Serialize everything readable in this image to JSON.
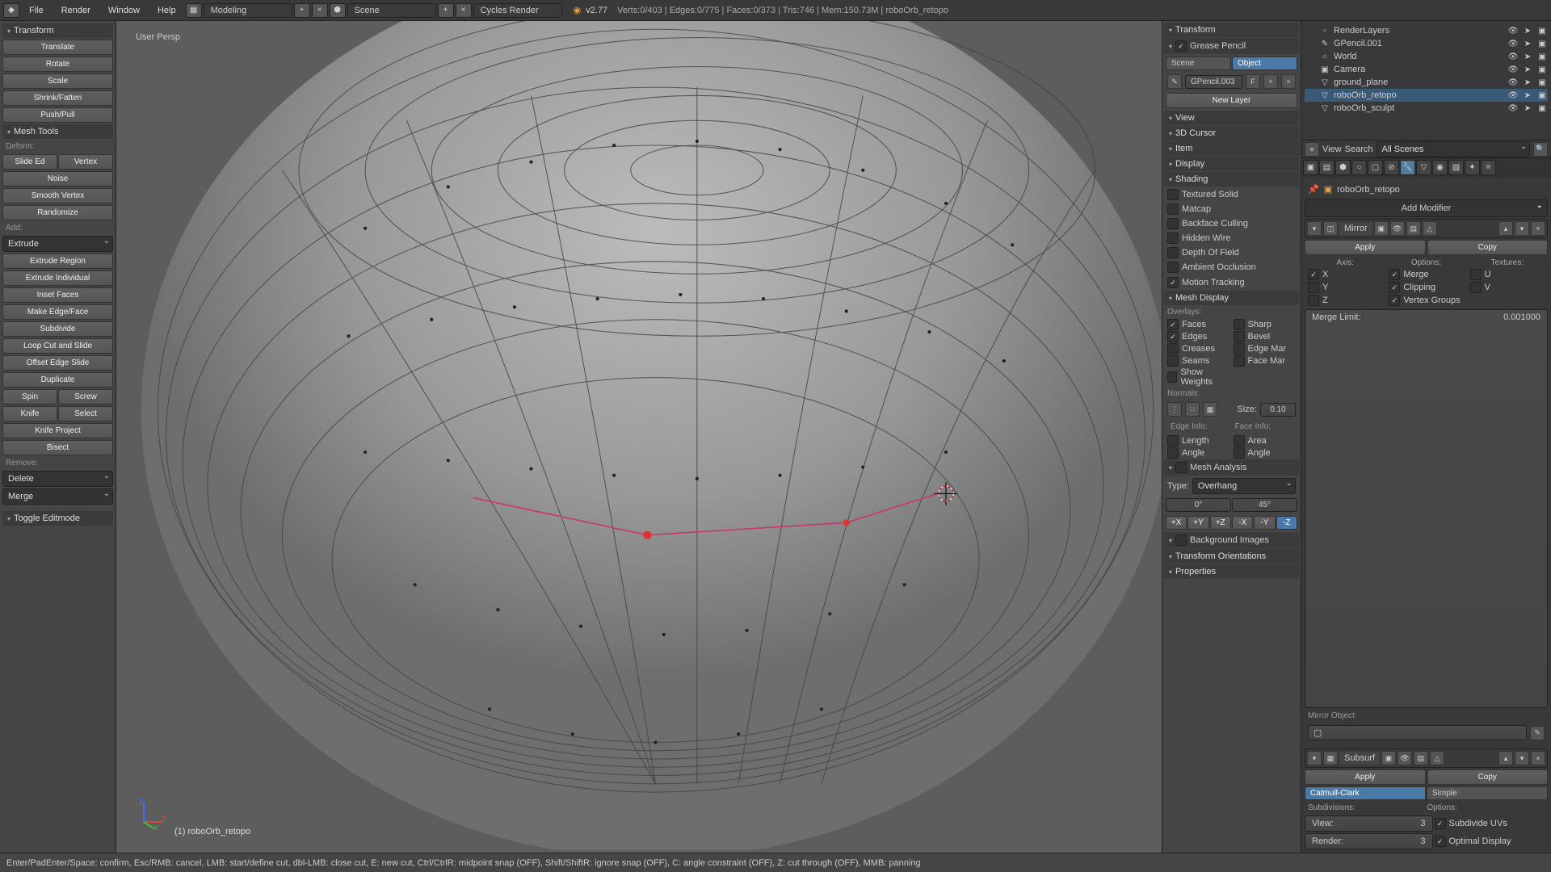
{
  "topbar": {
    "menus": [
      "File",
      "Render",
      "Window",
      "Help"
    ],
    "layout": "Modeling",
    "scene": "Scene",
    "engine": "Cycles Render",
    "version": "v2.77",
    "stats": "Verts:0/403 | Edges:0/775 | Faces:0/373 | Tris:746 | Mem:150.73M | roboOrb_retopo"
  },
  "toolshelf": {
    "transform_head": "Transform",
    "transform": [
      "Translate",
      "Rotate",
      "Scale",
      "Shrink/Fatten",
      "Push/Pull"
    ],
    "mesh_head": "Mesh Tools",
    "deform_label": "Deform:",
    "deform_pair": [
      "Slide Ed",
      "Vertex"
    ],
    "deform": [
      "Noise",
      "Smooth Vertex",
      "Randomize"
    ],
    "add_label": "Add:",
    "extrude": "Extrude",
    "add": [
      "Extrude Region",
      "Extrude Individual",
      "Inset Faces",
      "Make Edge/Face",
      "Subdivide",
      "Loop Cut and Slide",
      "Offset Edge Slide",
      "Duplicate"
    ],
    "spin_pair": [
      "Spin",
      "Screw"
    ],
    "knife_pair": [
      "Knife",
      "Select"
    ],
    "knife": [
      "Knife Project",
      "Bisect"
    ],
    "remove_label": "Remove:",
    "remove": [
      "Delete",
      "Merge"
    ],
    "history_head": "Toggle Editmode"
  },
  "viewport": {
    "persp": "User Persp",
    "object": "(1) roboOrb_retopo"
  },
  "npanel": {
    "sections_collapsed": [
      "Transform"
    ],
    "gp_head": "Grease Pencil",
    "gp_tabs": [
      "Scene",
      "Object"
    ],
    "gp_name": "GPencil.003",
    "gp_f": "F",
    "new_layer": "New Layer",
    "view": "View",
    "cursor": "3D Cursor",
    "item": "Item",
    "display": "Display",
    "shading_head": "Shading",
    "shading": [
      "Textured Solid",
      "Matcap",
      "Backface Culling",
      "Hidden Wire",
      "Depth Of Field",
      "Ambient Occlusion"
    ],
    "motion": "Motion Tracking",
    "mesh_disp_head": "Mesh Display",
    "overlays_label": "Overlays:",
    "overlay_left": [
      "Faces",
      "Edges",
      "Creases",
      "Seams",
      "Show Weights"
    ],
    "overlay_right": [
      "Sharp",
      "Bevel",
      "Edge Mar",
      "Face Mar"
    ],
    "normals_label": "Normals:",
    "size_label": "Size:",
    "size_val": "0.10",
    "edge_info": "Edge Info:",
    "face_info": "Face Info:",
    "info_left": [
      "Length",
      "Angle"
    ],
    "info_right": [
      "Area",
      "Angle"
    ],
    "mesh_analysis": "Mesh Analysis",
    "type_label": "Type:",
    "analysis_type": "Overhang",
    "angles": [
      "0°",
      "45°"
    ],
    "axes": [
      "+X",
      "+Y",
      "+Z",
      "-X",
      "-Y",
      "-Z"
    ],
    "bg_images": "Background Images",
    "xform_orient": "Transform Orientations",
    "properties": "Properties"
  },
  "outliner": {
    "header": {
      "view": "View",
      "search": "Search",
      "filter": "All Scenes"
    },
    "items": [
      {
        "icon": "▫",
        "name": "RenderLayers"
      },
      {
        "icon": "✎",
        "name": "GPencil.001"
      },
      {
        "icon": "○",
        "name": "World"
      },
      {
        "icon": "▣",
        "name": "Camera"
      },
      {
        "icon": "▽",
        "name": "ground_plane"
      },
      {
        "icon": "▽",
        "name": "roboOrb_retopo",
        "sel": true
      },
      {
        "icon": "▽",
        "name": "roboOrb_sculpt"
      }
    ]
  },
  "props": {
    "crumb_obj": "roboOrb_retopo",
    "add_modifier": "Add Modifier",
    "mirror": {
      "name": "Mirror",
      "apply": "Apply",
      "copy": "Copy",
      "axis_label": "Axis:",
      "options_label": "Options:",
      "textures_label": "Textures:",
      "axes": [
        "X",
        "Y",
        "Z"
      ],
      "options": [
        "Merge",
        "Clipping",
        "Vertex Groups"
      ],
      "textures": [
        "U",
        "V"
      ],
      "merge_limit_label": "Merge Limit:",
      "merge_limit": "0.001000",
      "mirror_obj_label": "Mirror Object:"
    },
    "subsurf": {
      "name": "Subsurf",
      "apply": "Apply",
      "copy": "Copy",
      "types": [
        "Catmull-Clark",
        "Simple"
      ],
      "subdiv_label": "Subdivisions:",
      "options_label": "Options:",
      "view_label": "View:",
      "view": "3",
      "render_label": "Render:",
      "render": "3",
      "opt1": "Subdivide UVs",
      "opt2": "Optimal Display"
    }
  },
  "status": {
    "text": "Enter/PadEnter/Space: confirm, Esc/RMB: cancel, LMB: start/define cut, dbl-LMB: close cut, E: new cut, Ctrl/CtrlR: midpoint snap (OFF), Shift/ShiftR: ignore snap (OFF), C: angle constraint (OFF), Z: cut through (OFF), MMB: panning"
  }
}
